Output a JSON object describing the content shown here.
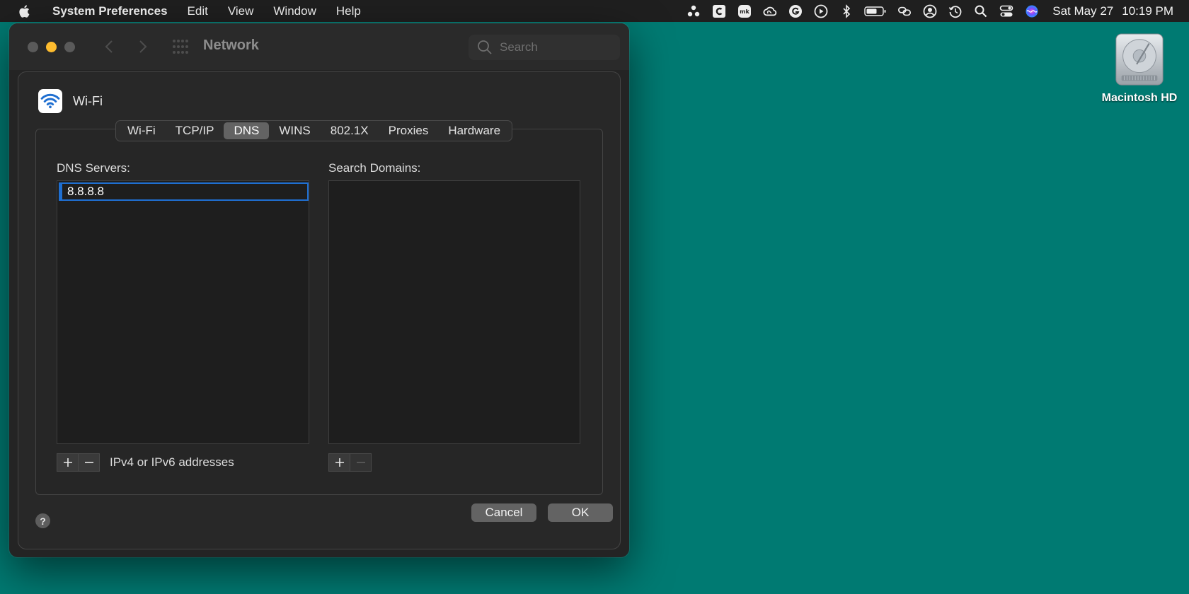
{
  "menubar": {
    "app_name": "System Preferences",
    "items": [
      "Edit",
      "View",
      "Window",
      "Help"
    ],
    "status_icons": [
      "dots-icon",
      "c-app-icon",
      "mk-app-icon",
      "creative-cloud-icon",
      "grammarly-icon",
      "play-icon",
      "bluetooth-icon",
      "battery-icon",
      "screen-mirroring-icon",
      "user-icon",
      "time-machine-icon",
      "spotlight-icon",
      "control-center-icon",
      "siri-icon"
    ],
    "date": "Sat May 27",
    "time": "10:19 PM"
  },
  "window": {
    "title": "Network",
    "search_placeholder": "Search"
  },
  "sheet": {
    "service_name": "Wi-Fi",
    "tabs": [
      "Wi-Fi",
      "TCP/IP",
      "DNS",
      "WINS",
      "802.1X",
      "Proxies",
      "Hardware"
    ],
    "active_tab": "DNS",
    "dns_servers_label": "DNS Servers:",
    "search_domains_label": "Search Domains:",
    "dns_servers": [
      "8.8.8.8"
    ],
    "search_domains": [],
    "dns_hint": "IPv4 or IPv6 addresses",
    "help_label": "?",
    "cancel_label": "Cancel",
    "ok_label": "OK"
  },
  "desktop": {
    "icon_label": "Macintosh HD"
  },
  "colors": {
    "desktop": "#007a72",
    "accent": "#1f6fd1",
    "minimize": "#febc2e"
  }
}
